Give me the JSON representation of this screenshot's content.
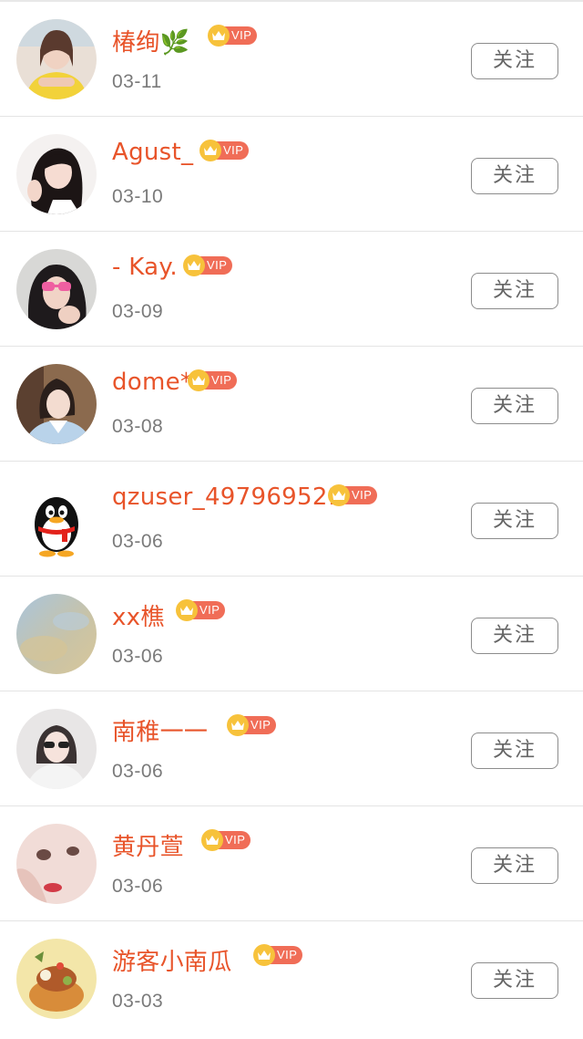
{
  "colors": {
    "name_text": "#e8542a",
    "vip_badge": "#f06d57",
    "crown": "#f7c23b",
    "date_text": "#7a7a7a",
    "button_border": "#8c8c8c"
  },
  "vip_label": "VIP",
  "follow_label": "关注",
  "users": [
    {
      "name": "椿绚🌿",
      "date": "03-11",
      "avatar": "avatar-photo-woman-yellow-top"
    },
    {
      "name": "Agust_",
      "date": "03-10",
      "avatar": "avatar-photo-woman-waving"
    },
    {
      "name": "- Kay.",
      "date": "03-09",
      "avatar": "avatar-photo-woman-pink-glasses"
    },
    {
      "name": "dome*",
      "date": "03-08",
      "avatar": "avatar-photo-man-blue-costume"
    },
    {
      "name": "qzuser_497969521",
      "date": "03-06",
      "avatar": "qq-penguin-icon"
    },
    {
      "name": "xx樵",
      "date": "03-06",
      "avatar": "avatar-photo-sky-blur"
    },
    {
      "name": "南稚一一",
      "date": "03-06",
      "avatar": "avatar-photo-girl-sunglasses"
    },
    {
      "name": "黄丹萱",
      "date": "03-06",
      "avatar": "avatar-photo-face-closeup"
    },
    {
      "name": "游客小南瓜",
      "date": "03-03",
      "avatar": "avatar-illustration-food"
    }
  ]
}
